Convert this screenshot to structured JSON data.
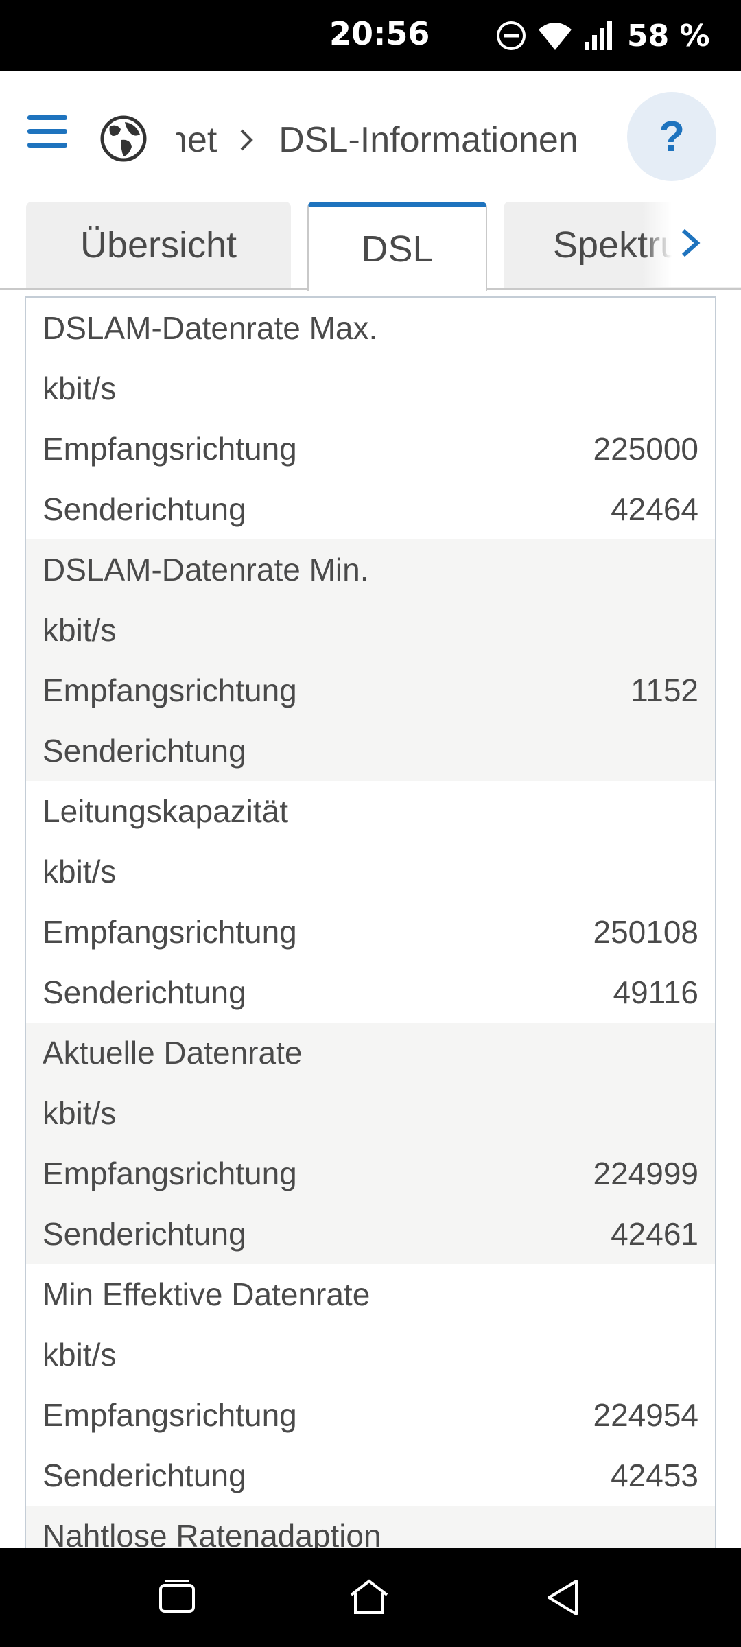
{
  "status_bar": {
    "time": "20:56",
    "battery": "58 %",
    "icons": [
      "do-not-disturb-icon",
      "wifi-icon",
      "signal-icon"
    ]
  },
  "header": {
    "breadcrumb_prev": "net",
    "breadcrumb_current": "DSL-Informationen",
    "help_label": "?"
  },
  "tabs": [
    {
      "label": "Übersicht",
      "active": false
    },
    {
      "label": "DSL",
      "active": true
    },
    {
      "label": "Spektrum",
      "active": false
    }
  ],
  "groups": [
    {
      "title": "DSLAM-Datenrate Max.",
      "unit": "kbit/s",
      "rows": [
        {
          "label": "Empfangsrichtung",
          "value": "225000"
        },
        {
          "label": "Senderichtung",
          "value": "42464"
        }
      ]
    },
    {
      "title": "DSLAM-Datenrate Min.",
      "unit": "kbit/s",
      "rows": [
        {
          "label": "Empfangsrichtung",
          "value": "1152"
        },
        {
          "label": "Senderichtung",
          "value": ""
        }
      ]
    },
    {
      "title": "Leitungskapazität",
      "unit": "kbit/s",
      "rows": [
        {
          "label": "Empfangsrichtung",
          "value": "250108"
        },
        {
          "label": "Senderichtung",
          "value": "49116"
        }
      ]
    },
    {
      "title": "Aktuelle Datenrate",
      "unit": "kbit/s",
      "rows": [
        {
          "label": "Empfangsrichtung",
          "value": "224999"
        },
        {
          "label": "Senderichtung",
          "value": "42461"
        }
      ]
    },
    {
      "title": "Min Effektive Datenrate",
      "unit": "kbit/s",
      "rows": [
        {
          "label": "Empfangsrichtung",
          "value": "224954"
        },
        {
          "label": "Senderichtung",
          "value": "42453"
        }
      ]
    },
    {
      "title": "Nahtlose Ratenadaption",
      "unit": "",
      "rows": []
    }
  ],
  "colors": {
    "accent": "#1e73be",
    "help_bg": "#e5edf6",
    "alt_row_bg": "#f5f5f4",
    "text": "#4a4a4a"
  }
}
